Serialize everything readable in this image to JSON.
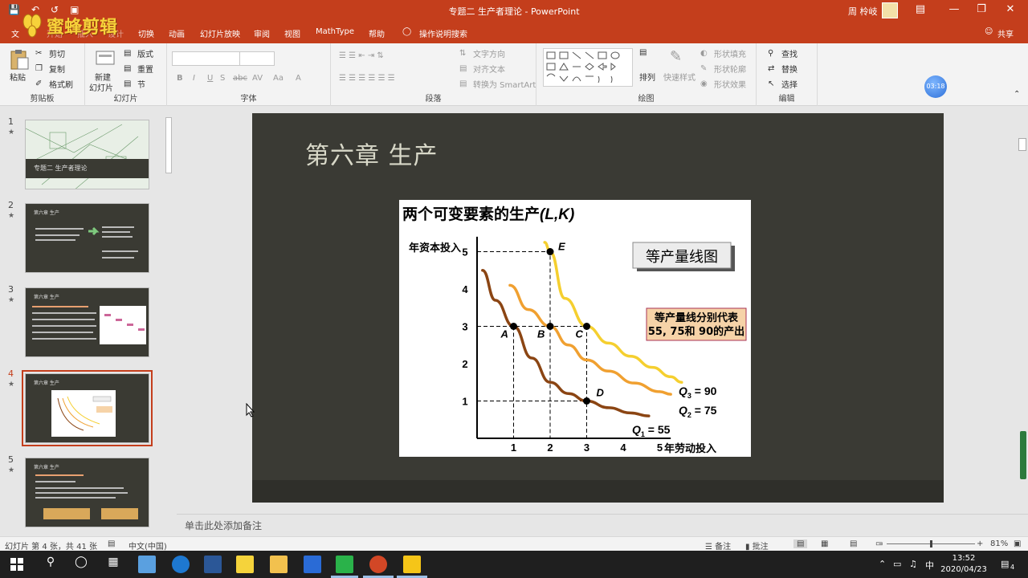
{
  "titlebar": {
    "doc_title": "专题二 生产者理论 - PowerPoint",
    "user_name": "周 柃岐",
    "qat": [
      "save-icon",
      "undo-icon",
      "redo-icon",
      "present-icon"
    ]
  },
  "watermark": {
    "text": "蜜蜂剪辑"
  },
  "tabs": [
    "文",
    "开始",
    "插入",
    "设计",
    "切换",
    "动画",
    "幻灯片放映",
    "审阅",
    "视图",
    "MathType",
    "帮助",
    "操作说明搜索",
    "共享"
  ],
  "ribbon": {
    "clipboard": {
      "paste": "粘贴",
      "cut": "剪切",
      "copy": "复制",
      "format_painter": "格式刷",
      "label": "剪贴板"
    },
    "slides": {
      "new_slide": "新建",
      "new_slide2": "幻灯片",
      "layout": "版式",
      "reset": "重置",
      "section": "节",
      "label": "幻灯片"
    },
    "font": {
      "label": "字体",
      "buttons": [
        "B",
        "I",
        "U",
        "S",
        "abc",
        "AV",
        "Aa",
        "A"
      ]
    },
    "paragraph": {
      "label": "段落",
      "text_direction": "文字方向",
      "align_text": "对齐文本",
      "smartart": "转换为 SmartArt"
    },
    "drawing": {
      "arrange": "排列",
      "quick_styles": "快速样式",
      "shape_fill": "形状填充",
      "shape_outline": "形状轮廓",
      "shape_effects": "形状效果",
      "label": "绘图"
    },
    "editing": {
      "find": "查找",
      "replace": "替换",
      "select": "选择",
      "label": "编辑"
    },
    "timer": "03:18"
  },
  "thumbnails": [
    {
      "num": "1",
      "title": "专题二 生产者理论"
    },
    {
      "num": "2",
      "title": "第六章 生产"
    },
    {
      "num": "3",
      "title": "第六章 生产"
    },
    {
      "num": "4",
      "title": "第六章 生产"
    },
    {
      "num": "5",
      "title": "第六章 生产"
    }
  ],
  "slide": {
    "title": "第六章 生产",
    "figure_title": "两个可变要素的生产",
    "figure_title_vars": "(L,K)",
    "ylabel": "年资本投入",
    "xlabel": "年劳动投入",
    "box_title": "等产量线图",
    "note_line1": "等产量线分别代表",
    "note_line2": "55, 75和 90的产出"
  },
  "chart_data": {
    "type": "line",
    "title": "两个可变要素的生产(L,K)",
    "xlabel": "年劳动投入",
    "ylabel": "年资本投入",
    "xlim": [
      0,
      5
    ],
    "ylim": [
      0,
      5
    ],
    "xticks": [
      "1",
      "2",
      "3",
      "4",
      "5"
    ],
    "yticks": [
      "1",
      "2",
      "3",
      "4",
      "5"
    ],
    "series": [
      {
        "name": "Q1 = 55",
        "color": "#8b4513",
        "x": [
          0.2,
          0.5,
          0.75,
          1,
          1.5,
          2,
          3,
          4,
          4.5
        ],
        "y": [
          4.4,
          3.7,
          3.3,
          3,
          2.1,
          1.5,
          1,
          0.75,
          0.6
        ]
      },
      {
        "name": "Q2 = 75",
        "color": "#f0a030",
        "x": [
          0.9,
          1.3,
          1.7,
          2,
          2.5,
          3,
          4,
          5.3
        ],
        "y": [
          4.1,
          3.55,
          3.2,
          3,
          2.5,
          2.1,
          1.55,
          1.2
        ]
      },
      {
        "name": "Q3 = 90",
        "color": "#f5cf2f",
        "x": [
          1.6,
          1.8,
          2,
          2.3,
          2.6,
          3,
          4,
          5.5
        ],
        "y": [
          4.3,
          4.0,
          5,
          3.45,
          3.2,
          3,
          2.2,
          1.5
        ]
      }
    ],
    "points": [
      {
        "label": "E",
        "x": 2,
        "y": 5
      },
      {
        "label": "A",
        "x": 1,
        "y": 3
      },
      {
        "label": "B",
        "x": 2,
        "y": 3
      },
      {
        "label": "C",
        "x": 3,
        "y": 3
      },
      {
        "label": "D",
        "x": 3,
        "y": 1
      }
    ],
    "q_labels": [
      {
        "q": "Q",
        "sub": "3",
        "val": "= 90"
      },
      {
        "q": "Q",
        "sub": "2",
        "val": "= 75"
      },
      {
        "q": "Q",
        "sub": "1",
        "val": "= 55"
      }
    ]
  },
  "notes": {
    "placeholder": "单击此处添加备注"
  },
  "status": {
    "slide_info": "幻灯片 第 4 张，共 41 张",
    "language": "中文(中国)",
    "notes_btn": "备注",
    "comments_btn": "批注",
    "zoom": "81%"
  },
  "taskbar": {
    "time": "13:52",
    "date": "2020/04/23",
    "ime": "中",
    "notif_count": "4"
  }
}
